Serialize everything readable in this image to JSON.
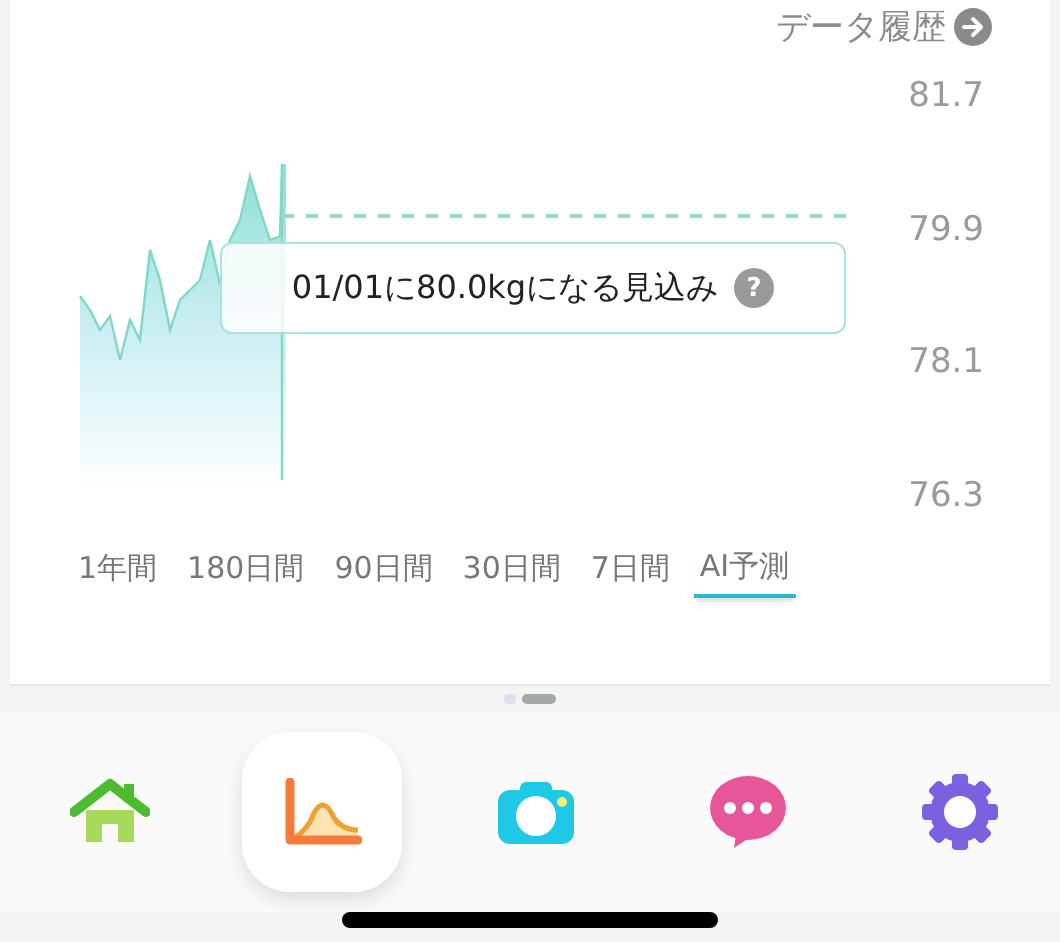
{
  "history_link": {
    "label": "データ履歴"
  },
  "chart": {
    "y_ticks": [
      "81.7",
      "79.9",
      "78.1",
      "76.3"
    ],
    "prediction": "01/01に80.0kgになる見込み",
    "help": "?"
  },
  "tabs": [
    {
      "label": "1年間",
      "selected": false
    },
    {
      "label": "180日間",
      "selected": false
    },
    {
      "label": "90日間",
      "selected": false
    },
    {
      "label": "30日間",
      "selected": false
    },
    {
      "label": "7日間",
      "selected": false
    },
    {
      "label": "AI予測",
      "selected": true
    }
  ],
  "pager": [
    {
      "selected": false
    },
    {
      "selected": true
    }
  ],
  "nav": [
    {
      "kind": "home",
      "selected": false
    },
    {
      "kind": "graph",
      "selected": true
    },
    {
      "kind": "camera",
      "selected": false
    },
    {
      "kind": "chat",
      "selected": false
    },
    {
      "kind": "settings",
      "selected": false
    }
  ]
}
